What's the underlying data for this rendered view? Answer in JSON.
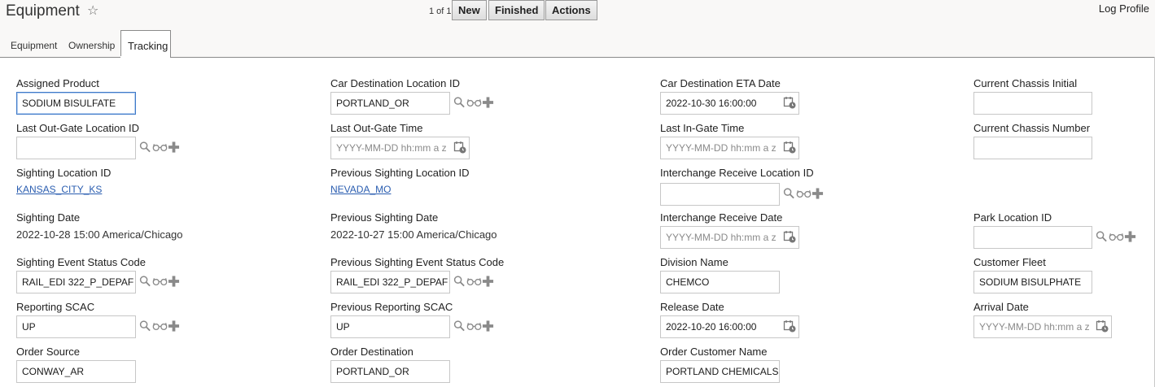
{
  "header": {
    "title": "Equipment",
    "pager": "1 of 1",
    "buttons": {
      "new": "New",
      "finished": "Finished",
      "actions": "Actions"
    },
    "log_profile": "Log Profile"
  },
  "tabs": [
    {
      "label": "Equipment",
      "active": false
    },
    {
      "label": "Ownership",
      "active": false
    },
    {
      "label": "Tracking",
      "active": true
    }
  ],
  "placeholders": {
    "datetime": "YYYY-MM-DD hh:mm a z"
  },
  "fields": {
    "assigned_product": {
      "label": "Assigned Product",
      "value": "SODIUM BISULFATE"
    },
    "car_destination_location_id": {
      "label": "Car Destination Location ID",
      "value": "PORTLAND_OR"
    },
    "car_destination_eta_date": {
      "label": "Car Destination ETA Date",
      "value": "2022-10-30 16:00:00"
    },
    "current_chassis_initial": {
      "label": "Current Chassis Initial",
      "value": ""
    },
    "last_out_gate_location_id": {
      "label": "Last Out-Gate Location ID",
      "value": ""
    },
    "last_out_gate_time": {
      "label": "Last Out-Gate Time",
      "value": ""
    },
    "last_in_gate_time": {
      "label": "Last In-Gate Time",
      "value": ""
    },
    "current_chassis_number": {
      "label": "Current Chassis Number",
      "value": ""
    },
    "sighting_location_id": {
      "label": "Sighting Location ID",
      "value": "KANSAS_CITY_KS"
    },
    "previous_sighting_location_id": {
      "label": "Previous Sighting Location ID",
      "value": "NEVADA_MO"
    },
    "interchange_receive_location_id": {
      "label": "Interchange Receive Location ID",
      "value": ""
    },
    "sighting_date": {
      "label": "Sighting Date",
      "value": "2022-10-28 15:00 America/Chicago"
    },
    "previous_sighting_date": {
      "label": "Previous Sighting Date",
      "value": "2022-10-27 15:00 America/Chicago"
    },
    "interchange_receive_date": {
      "label": "Interchange Receive Date",
      "value": ""
    },
    "park_location_id": {
      "label": "Park Location ID",
      "value": ""
    },
    "sighting_event_status_code": {
      "label": "Sighting Event Status Code",
      "value": "RAIL_EDI 322_P_DEPAF"
    },
    "previous_sighting_event_status_code": {
      "label": "Previous Sighting Event Status Code",
      "value": "RAIL_EDI 322_P_DEPAF"
    },
    "division_name": {
      "label": "Division Name",
      "value": "CHEMCO"
    },
    "customer_fleet": {
      "label": "Customer Fleet",
      "value": "SODIUM BISULPHATE"
    },
    "reporting_scac": {
      "label": "Reporting SCAC",
      "value": "UP"
    },
    "previous_reporting_scac": {
      "label": "Previous Reporting SCAC",
      "value": "UP"
    },
    "release_date": {
      "label": "Release Date",
      "value": "2022-10-20 16:00:00"
    },
    "arrival_date": {
      "label": "Arrival Date",
      "value": ""
    },
    "order_source": {
      "label": "Order Source",
      "value": "CONWAY_AR"
    },
    "order_destination": {
      "label": "Order Destination",
      "value": "PORTLAND_OR"
    },
    "order_customer_name": {
      "label": "Order Customer Name",
      "value": "PORTLAND CHEMICALS"
    }
  },
  "icons": {
    "search": "search-icon",
    "view": "glasses-icon",
    "add": "plus-icon",
    "calendar": "calendar-clock-icon",
    "favorite": "star-icon"
  },
  "colors": {
    "link": "#2a5db0",
    "focus_border": "#3f7ac8",
    "icon": "#8a8a8a"
  }
}
